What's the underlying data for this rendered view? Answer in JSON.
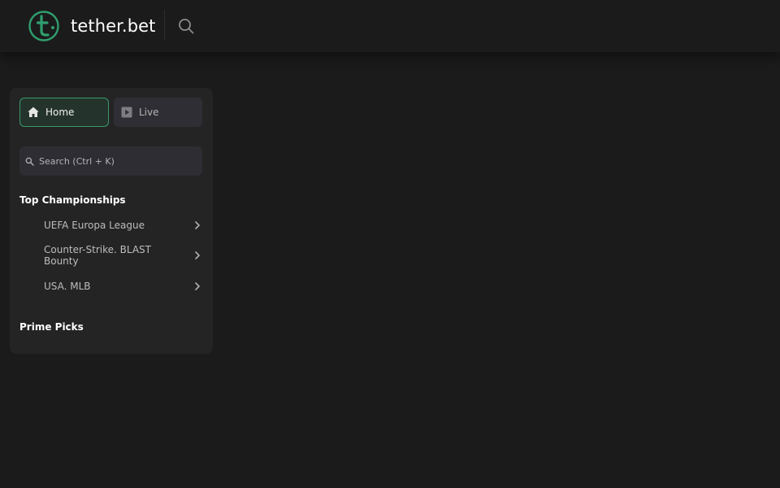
{
  "header": {
    "logo_text": "tether.bet",
    "logo_icon": "tether-logo-icon",
    "search_icon": "search-icon"
  },
  "sidebar": {
    "nav": {
      "home_label": "Home",
      "live_label": "Live"
    },
    "search": {
      "placeholder": "Search (Ctrl + K)"
    },
    "top_championships": {
      "title": "Top Championships",
      "items": [
        {
          "label": "UEFA Europa League"
        },
        {
          "label": "Counter-Strike. BLAST Bounty"
        },
        {
          "label": "USA. MLB"
        }
      ]
    },
    "prime_picks": {
      "title": "Prime Picks"
    }
  },
  "colors": {
    "background": "#1b1b1b",
    "panel": "#242424",
    "accent": "#3a9a6c",
    "logo_green": "#2f9e6e"
  }
}
